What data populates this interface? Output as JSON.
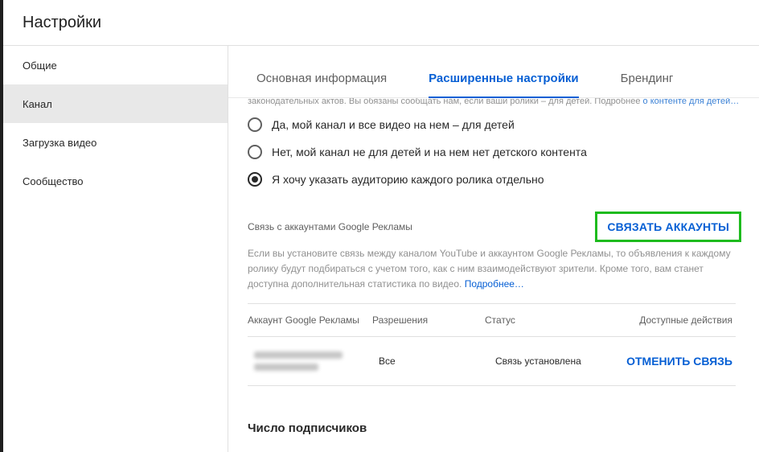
{
  "header": {
    "title": "Настройки"
  },
  "sidebar": {
    "items": [
      {
        "label": "Общие"
      },
      {
        "label": "Канал"
      },
      {
        "label": "Загрузка видео"
      },
      {
        "label": "Сообщество"
      }
    ],
    "active_index": 1
  },
  "tabs": {
    "items": [
      {
        "label": "Основная информация"
      },
      {
        "label": "Расширенные настройки"
      },
      {
        "label": "Брендинг"
      }
    ],
    "active_index": 1
  },
  "audience": {
    "cut_text": "законодательных актов. Вы обязаны сообщать нам, если ваши ролики – для детей. Подробнее",
    "cut_link": "о контенте для детей…",
    "options": [
      {
        "label": "Да, мой канал и все видео на нем – для детей",
        "checked": false
      },
      {
        "label": "Нет, мой канал не для детей и на нем нет детского контента",
        "checked": false
      },
      {
        "label": "Я хочу указать аудиторию каждого ролика отдельно",
        "checked": true
      }
    ]
  },
  "ads": {
    "section_label": "Связь с аккаунтами Google Рекламы",
    "link_button": "СВЯЗАТЬ АККАУНТЫ",
    "description": "Если вы установите связь между каналом YouTube и аккаунтом Google Рекламы, то объявления к каждому ролику будут подбираться с учетом того, как с ним взаимодействуют зрители. Кроме того, вам станет доступна дополнительная статистика по видео.",
    "description_link": "Подробнее…",
    "table": {
      "headers": [
        "Аккаунт Google Рекламы",
        "Разрешения",
        "Статус",
        "Доступные действия"
      ],
      "rows": [
        {
          "permissions": "Все",
          "status": "Связь установлена",
          "action": "ОТМЕНИТЬ СВЯЗЬ"
        }
      ]
    },
    "highlight_color": "#1ebb1e"
  },
  "subscribers": {
    "title": "Число подписчиков"
  },
  "colors": {
    "accent": "#065fd4",
    "active_nav_bg": "#e8e8e8"
  }
}
